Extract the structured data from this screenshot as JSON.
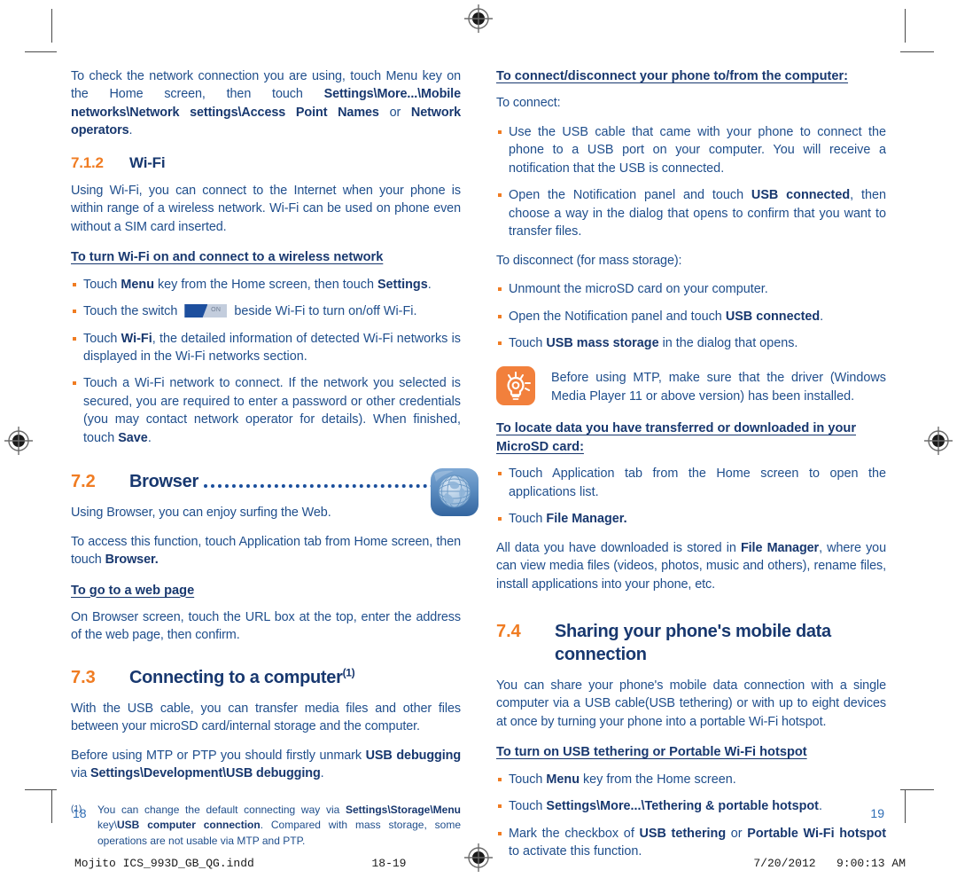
{
  "document": {
    "print_footer": {
      "filename": "Mojito ICS_993D_GB_QG.indd",
      "spread": "18-19",
      "date": "7/20/2012",
      "time": "9:00:13 AM"
    }
  },
  "colors": {
    "body_text": "#1f4e8c",
    "heading": "#18386f",
    "accent_orange": "#f07c22",
    "bullet": "#f07c22",
    "tip_icon_bg": "#f2803c",
    "browser_icon_bg": "#4f86c2",
    "page_number": "#2e6db5"
  },
  "left_page": {
    "page_number": "18",
    "intro_paragraph": {
      "part1": "To check the network connection you are using, touch Menu key on the Home screen, then touch ",
      "bold1": "Settings\\More...\\Mobile networks\\Network settings\\Access Point Names",
      "mid": " or ",
      "bold2": "Network operators",
      "end": "."
    },
    "wifi_heading": {
      "number": "7.1.2",
      "title": "Wi-Fi"
    },
    "wifi_intro": "Using Wi-Fi, you can connect to the Internet when your phone is within range of a wireless network. Wi-Fi can be used on phone even without a SIM card inserted.",
    "wifi_turn_on_heading": "To turn Wi-Fi on and connect to a wireless network",
    "wifi_bullets": [
      {
        "segments": [
          {
            "text": "Touch ",
            "bold": false
          },
          {
            "text": "Menu",
            "bold": true
          },
          {
            "text": " key from the Home screen, then touch ",
            "bold": false
          },
          {
            "text": "Settings",
            "bold": true
          },
          {
            "text": ".",
            "bold": false
          }
        ]
      },
      {
        "segments": [
          {
            "text": "Touch the switch ",
            "bold": false
          },
          {
            "text": "__SWITCH__",
            "bold": false
          },
          {
            "text": " beside Wi-Fi to  turn on/off Wi-Fi.",
            "bold": false
          }
        ]
      },
      {
        "segments": [
          {
            "text": "Touch ",
            "bold": false
          },
          {
            "text": "Wi-Fi",
            "bold": true
          },
          {
            "text": ", the detailed information of detected Wi-Fi networks is displayed in the Wi-Fi networks section.",
            "bold": false
          }
        ]
      },
      {
        "segments": [
          {
            "text": "Touch a Wi-Fi network to connect. If the network you selected is secured, you are required to enter a password or other credentials (you may contact network operator for details). When finished, touch ",
            "bold": false
          },
          {
            "text": "Save",
            "bold": true
          },
          {
            "text": ".",
            "bold": false
          }
        ]
      }
    ],
    "browser_heading": {
      "number": "7.2",
      "title": "Browser",
      "icon": "browser-globe-icon"
    },
    "browser_paragraph_1": "Using Browser, you can enjoy surfing the Web.",
    "browser_paragraph_2": {
      "part1": "To access this function, touch Application tab from Home screen, then touch ",
      "bold1": "Browser.",
      "end": ""
    },
    "web_page_heading": "To go to a web page",
    "web_page_paragraph": "On Browser screen, touch the URL box at the top, enter the address of the web page, then confirm.",
    "computer_heading": {
      "number": "7.3",
      "title": "Connecting to a computer",
      "superscript": "(1)"
    },
    "computer_paragraph_1": "With the USB cable, you can transfer media files and other files between your microSD card/internal storage and the computer.",
    "computer_paragraph_2": {
      "part1": "Before using MTP or PTP you should firstly unmark ",
      "bold1": "USB debugging",
      "mid": " via ",
      "bold2": "Settings\\Development\\USB debugging",
      "end": "."
    },
    "footnote": {
      "mark": "(1)",
      "part1": "You can change the default connecting way via ",
      "bold1": "Settings\\Storage\\Menu",
      "mid1": " key\\",
      "bold2": "USB computer connection",
      "end": ". Compared with mass storage, some operations are not usable via MTP and PTP."
    }
  },
  "right_page": {
    "page_number": "19",
    "connect_heading": "To connect/disconnect your phone to/from the computer:",
    "to_connect_label": "To connect:",
    "connect_bullets": [
      {
        "segments": [
          {
            "text": "Use the USB cable that came with your phone to connect the phone to a USB port on your computer. You will receive a notification that the USB is connected.",
            "bold": false
          }
        ]
      },
      {
        "segments": [
          {
            "text": "Open the Notification panel and touch ",
            "bold": false
          },
          {
            "text": "USB connected",
            "bold": true
          },
          {
            "text": ", then choose a way in the dialog that opens to confirm that you want to transfer files.",
            "bold": false
          }
        ]
      }
    ],
    "to_disconnect_label": "To disconnect (for mass storage):",
    "disconnect_bullets": [
      {
        "segments": [
          {
            "text": "Unmount the microSD card on your computer.",
            "bold": false
          }
        ]
      },
      {
        "segments": [
          {
            "text": "Open the Notification panel and touch ",
            "bold": false
          },
          {
            "text": "USB connected",
            "bold": true
          },
          {
            "text": ".",
            "bold": false
          }
        ]
      },
      {
        "segments": [
          {
            "text": "Touch ",
            "bold": false
          },
          {
            "text": "USB mass storage",
            "bold": true
          },
          {
            "text": " in the dialog that opens.",
            "bold": false
          }
        ]
      }
    ],
    "tip": {
      "icon": "lightbulb-tip-icon",
      "text": "Before using MTP, make sure that the driver (Windows Media Player 11 or above version) has been installed."
    },
    "locate_heading": "To locate data you have transferred or downloaded in your MicroSD card:",
    "locate_bullets": [
      {
        "segments": [
          {
            "text": "Touch Application tab from the Home screen to open the applications list.",
            "bold": false
          }
        ]
      },
      {
        "segments": [
          {
            "text": "Touch ",
            "bold": false
          },
          {
            "text": "File Manager.",
            "bold": true
          }
        ]
      }
    ],
    "locate_paragraph": {
      "part1": "All data you have downloaded is stored in ",
      "bold1": "File Manager",
      "end": ", where you can view media files (videos, photos, music and others), rename files, install applications into your phone, etc."
    },
    "sharing_heading": {
      "number": "7.4",
      "title": "Sharing your phone's mobile data connection"
    },
    "sharing_paragraph": "You can share your phone's mobile data connection with a single computer via a USB cable(USB tethering) or with up to eight devices at once by turning your phone into a portable Wi-Fi hotspot.",
    "tethering_heading": "To turn on USB tethering or Portable Wi-Fi hotspot",
    "tethering_bullets": [
      {
        "segments": [
          {
            "text": "Touch ",
            "bold": false
          },
          {
            "text": "Menu",
            "bold": true
          },
          {
            "text": " key from the Home screen.",
            "bold": false
          }
        ]
      },
      {
        "segments": [
          {
            "text": "Touch ",
            "bold": false
          },
          {
            "text": "Settings\\More...\\Tethering & portable hotspot",
            "bold": true
          },
          {
            "text": ".",
            "bold": false
          }
        ]
      },
      {
        "segments": [
          {
            "text": "Mark the checkbox of ",
            "bold": false
          },
          {
            "text": "USB tethering",
            "bold": true
          },
          {
            "text": " or ",
            "bold": false
          },
          {
            "text": "Portable Wi-Fi hotspot",
            "bold": true
          },
          {
            "text": " to activate this function.",
            "bold": false
          }
        ]
      }
    ]
  }
}
